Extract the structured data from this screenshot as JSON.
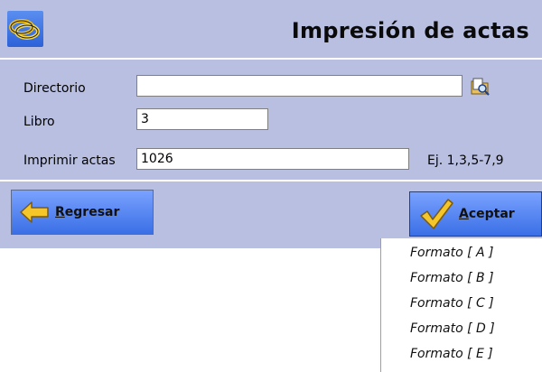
{
  "window": {
    "title": "Impresión de actas"
  },
  "form": {
    "directorio": {
      "label": "Directorio",
      "value": ""
    },
    "libro": {
      "label": "Libro",
      "value": "3"
    },
    "imprimir": {
      "label": "Imprimir actas",
      "value": "1026"
    },
    "hint": "Ej. 1,3,5-7,9"
  },
  "buttons": {
    "back": {
      "label_key": "R",
      "label_rest": "egresar"
    },
    "ok": {
      "label_key": "A",
      "label_rest": "ceptar"
    }
  },
  "format_menu": {
    "items": [
      "Formato [ A ]",
      "Formato [ B ]",
      "Formato [ C ]",
      "Formato [ D ]",
      "Formato [ E ]"
    ]
  },
  "icons": {
    "app": "rings-icon",
    "browse": "folder-search-icon",
    "back": "back-arrow-icon",
    "ok": "checkmark-icon"
  },
  "colors": {
    "dialog_bg": "#b9bfe1",
    "button_blue": "#4a7cf0",
    "icon_yellow": "#f2c21a"
  }
}
